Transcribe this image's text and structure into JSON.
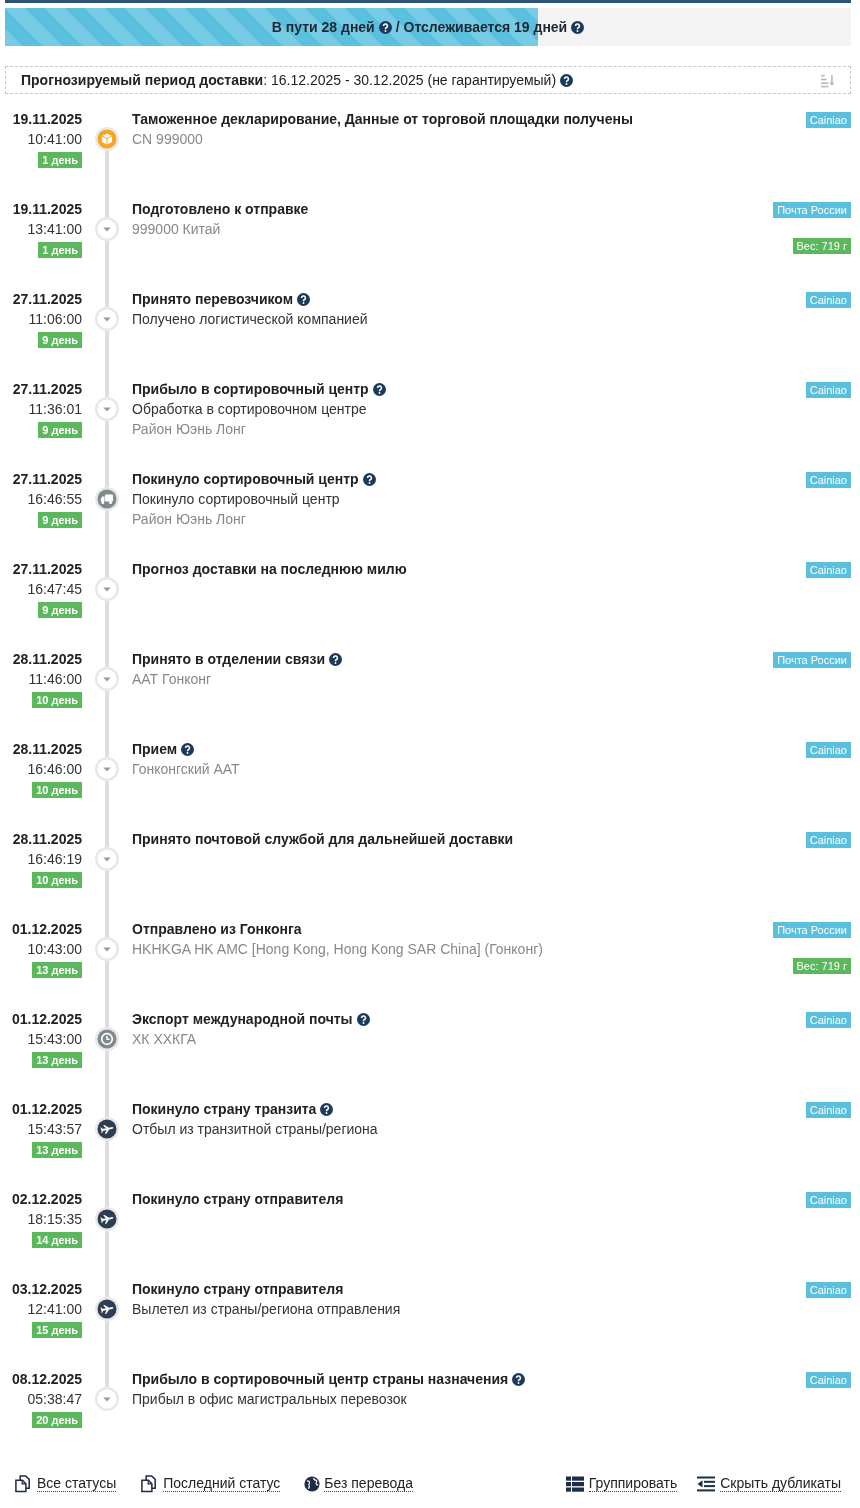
{
  "progress": {
    "level": 0.63,
    "segments": [
      {
        "text": "В пути 28 дней",
        "help": true
      },
      {
        "text": "/ Отслеживается 19 дней",
        "help": true
      }
    ]
  },
  "forecast": {
    "text": "**Прогнозируемый период доставки**: 16.12.2025 - 30.12.2025 (не гарантируемый)",
    "help": true
  },
  "events": [
    {
      "kind": "package",
      "date": "19.11.2025",
      "time": "10:41:00",
      "day": "1 день",
      "title": "Таможенное декларирование, Данные от торговой площадки получены",
      "help": false,
      "details": [
        {
          "kind": "location",
          "text": "CN 999000"
        }
      ],
      "carrier": "Cainiao"
    },
    {
      "kind": "step",
      "date": "19.11.2025",
      "time": "13:41:00",
      "day": "1 день",
      "title": "Подготовлено к отправке",
      "help": false,
      "details": [
        {
          "kind": "location",
          "text": "999000 Китай"
        }
      ],
      "carrier": "Почта России",
      "weight": "Вес: 719 г"
    },
    {
      "kind": "step",
      "date": "27.11.2025",
      "time": "11:06:00",
      "day": "9 день",
      "title": "Принято перевозчиком",
      "help": true,
      "details": [
        {
          "kind": "description",
          "text": "Получено логистической компанией"
        }
      ],
      "carrier": "Cainiao"
    },
    {
      "kind": "step",
      "date": "27.11.2025",
      "time": "11:36:01",
      "day": "9 день",
      "title": "Прибыло в сортировочный центр",
      "help": true,
      "details": [
        {
          "kind": "description",
          "text": "Обработка в сортировочном центре"
        },
        {
          "kind": "location",
          "text": "Район Юэнь Лонг"
        }
      ],
      "carrier": "Cainiao"
    },
    {
      "kind": "truck",
      "date": "27.11.2025",
      "time": "16:46:55",
      "day": "9 день",
      "title": "Покинуло сортировочный центр",
      "help": true,
      "details": [
        {
          "kind": "description",
          "text": "Покинуло сортировочный центр"
        },
        {
          "kind": "location",
          "text": "Район Юэнь Лонг"
        }
      ],
      "carrier": "Cainiao"
    },
    {
      "kind": "step",
      "date": "27.11.2025",
      "time": "16:47:45",
      "day": "9 день",
      "title": "Прогноз доставки на последнюю милю",
      "help": false,
      "carrier": "Cainiao"
    },
    {
      "kind": "step",
      "date": "28.11.2025",
      "time": "11:46:00",
      "day": "10 день",
      "title": "Принято в отделении связи",
      "help": true,
      "details": [
        {
          "kind": "location",
          "text": "ААТ Гонконг"
        }
      ],
      "carrier": "Почта России"
    },
    {
      "kind": "step",
      "date": "28.11.2025",
      "time": "16:46:00",
      "day": "10 день",
      "title": "Прием",
      "help": true,
      "details": [
        {
          "kind": "location",
          "text": "Гонконгский ААТ"
        }
      ],
      "carrier": "Cainiao"
    },
    {
      "kind": "step",
      "date": "28.11.2025",
      "time": "16:46:19",
      "day": "10 день",
      "title": "Принято почтовой службой для дальнейшей доставки",
      "help": false,
      "carrier": "Cainiao"
    },
    {
      "kind": "step",
      "date": "01.12.2025",
      "time": "10:43:00",
      "day": "13 день",
      "title": "Отправлено из Гонконга",
      "help": false,
      "details": [
        {
          "kind": "location",
          "text": "HKHKGA HK AMC [Hong Kong, Hong Kong SAR China] (Гонконг)"
        }
      ],
      "carrier": "Почта России",
      "weight": "Вес: 719 г"
    },
    {
      "kind": "clock",
      "date": "01.12.2025",
      "time": "15:43:00",
      "day": "13 день",
      "title": "Экспорт международной почты",
      "help": true,
      "details": [
        {
          "kind": "location",
          "text": "ХК ХХКГА"
        }
      ],
      "carrier": "Cainiao"
    },
    {
      "kind": "flight",
      "date": "01.12.2025",
      "time": "15:43:57",
      "day": "13 день",
      "title": "Покинуло страну транзита",
      "help": true,
      "details": [
        {
          "kind": "description",
          "text": "Отбыл из транзитной страны/региона"
        }
      ],
      "carrier": "Cainiao"
    },
    {
      "kind": "flight",
      "date": "02.12.2025",
      "time": "18:15:35",
      "day": "14 день",
      "title": "Покинуло страну отправителя",
      "help": false,
      "carrier": "Cainiao"
    },
    {
      "kind": "flight",
      "date": "03.12.2025",
      "time": "12:41:00",
      "day": "15 день",
      "title": "Покинуло страну отправителя",
      "help": false,
      "details": [
        {
          "kind": "description",
          "text": "Вылетел из страны/региона отправления"
        }
      ],
      "carrier": "Cainiao"
    },
    {
      "kind": "step",
      "date": "08.12.2025",
      "time": "05:38:47",
      "day": "20 день",
      "title": "Прибыло в сортировочный центр страны назначения",
      "help": true,
      "details": [
        {
          "kind": "description",
          "text": "Прибыл в офис магистральных перевозок"
        }
      ],
      "carrier": "Cainiao"
    }
  ],
  "footer": {
    "left": [
      {
        "kind": "copy",
        "label": "Все статусы"
      },
      {
        "kind": "copy",
        "label": "Последний статус"
      },
      {
        "kind": "globe",
        "label": "Без перевода"
      }
    ],
    "right": [
      {
        "kind": "list",
        "label": "Группировать"
      },
      {
        "kind": "outdent",
        "label": "Скрыть дубликаты"
      }
    ]
  }
}
